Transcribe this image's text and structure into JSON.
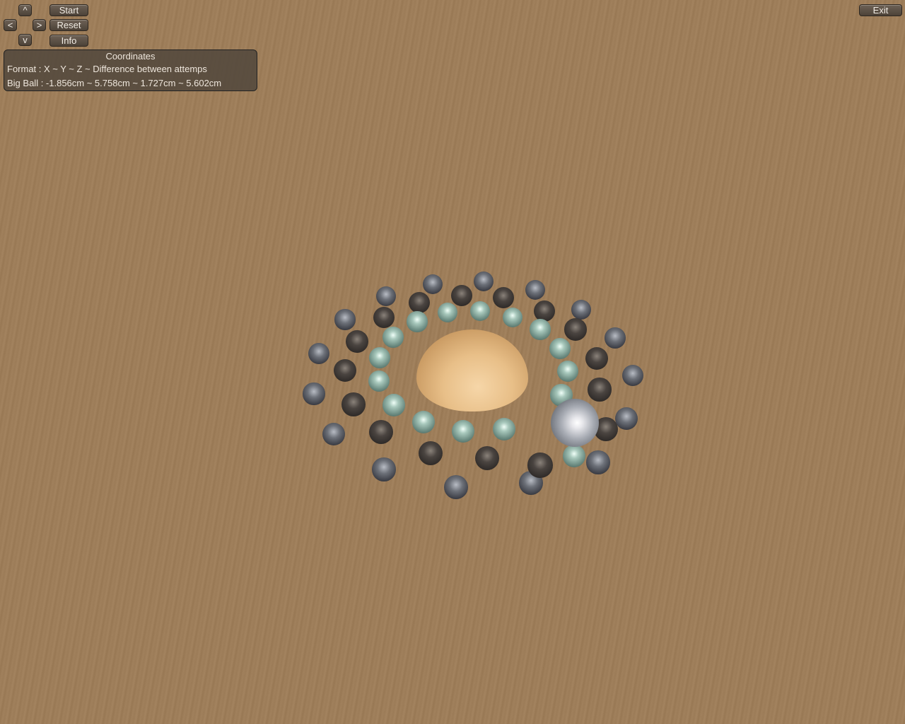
{
  "controls": {
    "up": "^",
    "left": "<",
    "right": ">",
    "down": "v",
    "start": "Start",
    "reset": "Reset",
    "info": "Info",
    "exit": "Exit"
  },
  "coordinates": {
    "title": "Coordinates",
    "format": "Format : X ~ Y ~ Z ~ Difference between attemps",
    "big_ball": "Big Ball : -1.856cm ~ 5.758cm ~ 1.727cm ~ 5.602cm"
  },
  "colors": {
    "table": "#a0805c",
    "panel": "#50463c"
  }
}
